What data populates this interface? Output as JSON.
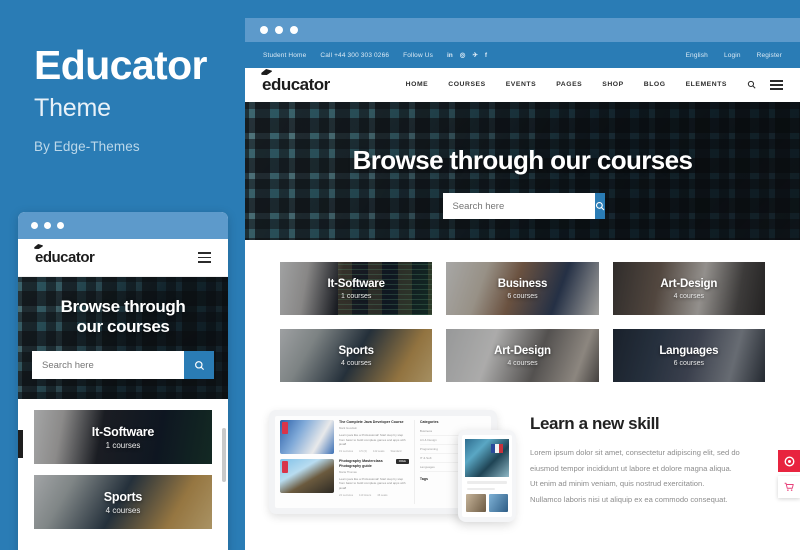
{
  "promo": {
    "title": "Educator",
    "subtitle": "Theme",
    "byline": "By Edge-Themes",
    "accent_blue": "#2a7cb5",
    "chrome_blue": "#5d9acb"
  },
  "topbar": {
    "student_home": "Student Home",
    "phone": "Call +44 300 303 0266",
    "follow_us": "Follow Us",
    "socials": [
      "in",
      "◎",
      "✈",
      "f"
    ],
    "language": "English",
    "login": "Login",
    "register": "Register"
  },
  "nav": {
    "logo": "educator",
    "links": [
      "HOME",
      "COURSES",
      "EVENTS",
      "PAGES",
      "SHOP",
      "BLOG",
      "ELEMENTS"
    ],
    "search_icon": "search-icon",
    "menu_icon": "hamburger-icon"
  },
  "hero": {
    "heading": "Browse through our courses",
    "heading_mobile_line1": "Browse through",
    "heading_mobile_line2": "our courses",
    "search_placeholder": "Search here",
    "search_value": "",
    "search_button_icon": "search-icon"
  },
  "categories": {
    "row1": [
      {
        "title": "It-Software",
        "count": "1 courses",
        "bg": "bg-code"
      },
      {
        "title": "Business",
        "count": "6 courses",
        "bg": "bg-business"
      },
      {
        "title": "Art-Design",
        "count": "4 courses",
        "bg": "bg-artdesign"
      }
    ],
    "row2": [
      {
        "title": "Sports",
        "count": "4 courses",
        "bg": "bg-sports"
      },
      {
        "title": "Art-Design",
        "count": "4 courses",
        "bg": "bg-artdesign2"
      },
      {
        "title": "Languages",
        "count": "6 courses",
        "bg": "bg-languages"
      }
    ],
    "mobile": [
      {
        "title": "It-Software",
        "count": "1 courses",
        "bg": "bg-mob-code"
      },
      {
        "title": "Sports",
        "count": "4 courses",
        "bg": "bg-mob-sports"
      }
    ]
  },
  "learn": {
    "heading": "Learn a new skill",
    "paragraph_lines": [
      "Lorem ipsum dolor sit amet, consectetur adipiscing elit, sed do",
      "eiusmod tempor incididunt ut labore et dolore magna aliqua.",
      "Ut enim ad minim veniam, quis nostrud exercitation.",
      "Nullamco laboris nisi ut aliquip ex ea commodo consequat."
    ]
  },
  "tablet_preview": {
    "courses": [
      {
        "title": "The Complete Java Developer Course",
        "author": "Mark Goodwin",
        "desc": "Learn java like a Professional! Start step by step from basic to build complete games and apps with java8",
        "meta": [
          "19 Lectures",
          "4.5 (3)",
          "142 seats",
          "Standard"
        ],
        "tag": ""
      },
      {
        "title": "Photography Masterclass Photography guide",
        "author": "Maria Thomas",
        "desc": "Learn java like a Professional! Start step by step from basic to build complete games and apps with java8",
        "meta": [
          "24 Lectures",
          "113 Hours",
          "46 seats"
        ],
        "tag": "FREE"
      }
    ],
    "sidebar_heading": "Categories",
    "sidebar_items": [
      "Business",
      "Art & Design",
      "Programming",
      "IT & Soft",
      "Languages"
    ],
    "sidebar_heading2": "Tags"
  },
  "floating_buttons": [
    {
      "name": "purchase-button",
      "icon": "◉",
      "color": "#e8243f"
    },
    {
      "name": "cart-button",
      "icon": "🛒",
      "color": "#e8417a"
    }
  ]
}
